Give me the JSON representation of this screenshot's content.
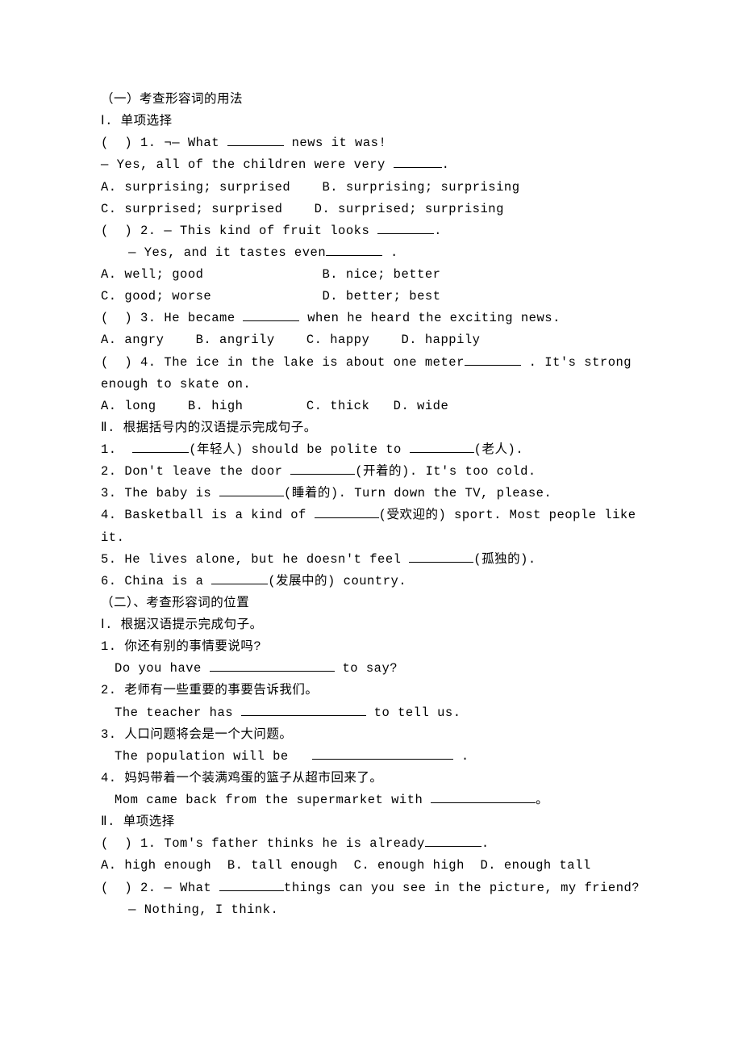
{
  "s1": {
    "title": "（一）考查形容词的用法",
    "part1": {
      "title": "Ⅰ. 单项选择",
      "q1": {
        "prefix": "(  ) 1. ¬— What ",
        "mid": " news it was!",
        "l2a": "— Yes, all of the children were very ",
        "l2b": ".",
        "optA": "A. surprising; surprised",
        "optB": "B. surprising; surprising",
        "optC": "C. surprised; surprised",
        "optD": "D. surprised; surprising"
      },
      "q2": {
        "l1a": "(  ) 2. — This kind of fruit looks ",
        "l1b": ".",
        "l2a": "— Yes, and it tastes even",
        "l2b": " .",
        "optA": "A. well; good",
        "optB": "B. nice; better",
        "optC": "C. good; worse",
        "optD": "D. better; best"
      },
      "q3": {
        "l1a": "(  ) 3. He became ",
        "l1b": " when he heard the exciting news.",
        "opts": "A. angry    B. angrily    C. happy    D. happily"
      },
      "q4": {
        "l1a": "(  ) 4. The ice in the lake is about one meter",
        "l1b": " . It's strong",
        "l2": "enough to skate on.",
        "opts": "A. long    B. high        C. thick   D. wide"
      }
    },
    "part2": {
      "title": "Ⅱ. 根据括号内的汉语提示完成句子。",
      "q1a": "1.  ",
      "q1b": "(年轻人) should be polite to ",
      "q1c": "(老人).",
      "q2a": "2. Don't leave the door ",
      "q2b": "(开着的). It's too cold.",
      "q3a": "3. The baby is ",
      "q3b": "(睡着的). Turn down the TV, please.",
      "q4a": "4. Basketball is a kind of ",
      "q4b": "(受欢迎的) sport. Most people like",
      "q4c": "it.",
      "q5a": "5. He lives alone, but he doesn't feel ",
      "q5b": "(孤独的).",
      "q6a": "6. China is a ",
      "q6b": "(发展中的) country."
    }
  },
  "s2": {
    "title": "（二）、考查形容词的位置",
    "part1": {
      "title": "Ⅰ. 根据汉语提示完成句子。",
      "q1": "1. 你还有别的事情要说吗?",
      "q1en_a": "Do you have ",
      "q1en_b": " to say?",
      "q2": "2. 老师有一些重要的事要告诉我们。",
      "q2en_a": "The teacher has ",
      "q2en_b": " to tell us.",
      "q3": "3. 人口问题将会是一个大问题。",
      "q3en_a": "The population will be   ",
      "q3en_b": " .",
      "q4": "4. 妈妈带着一个装满鸡蛋的篮子从超市回来了。",
      "q4en_a": "Mom came back from the supermarket with ",
      "q4en_b": "。"
    },
    "part2": {
      "title": "Ⅱ. 单项选择",
      "q1a": "(  ) 1. Tom's father thinks he is already",
      "q1b": ".",
      "q1opts": "A. high enough  B. tall enough  C. enough high  D. enough tall",
      "q2a": "(  ) 2. — What ",
      "q2b": "things can you see in the picture, my friend?",
      "q2c": "— Nothing, I think."
    }
  }
}
